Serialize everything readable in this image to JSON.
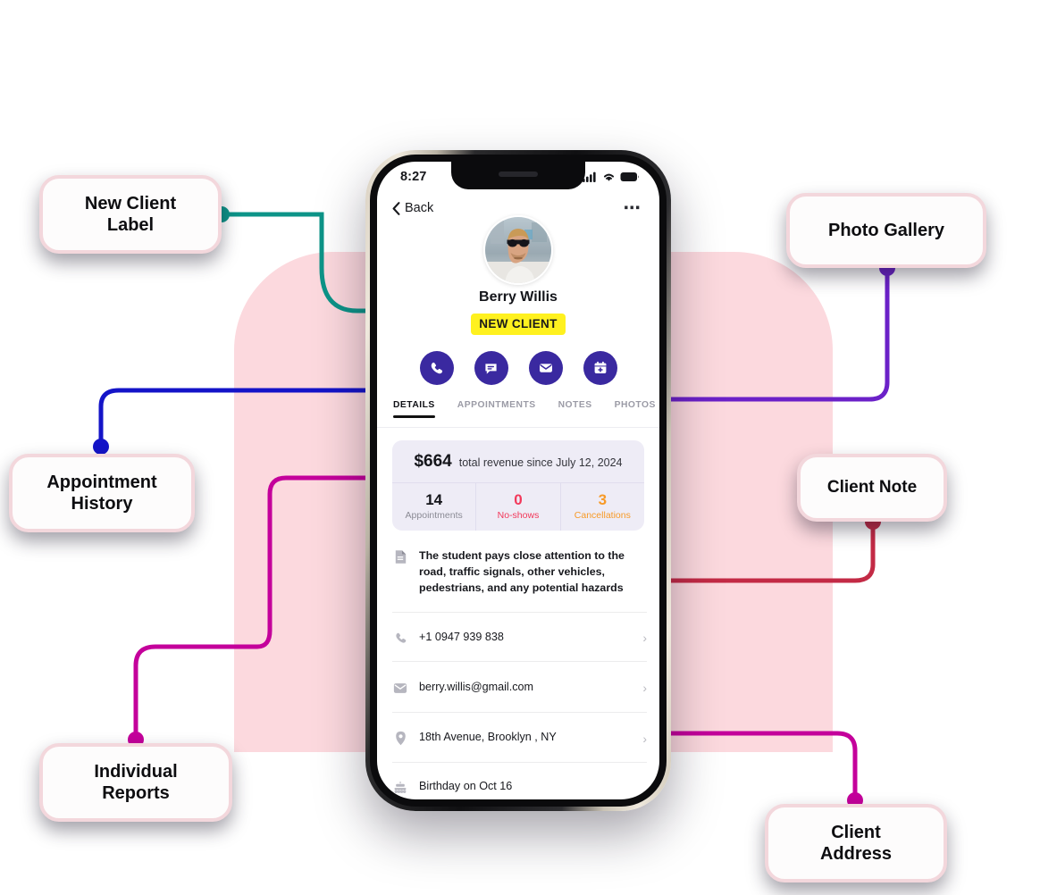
{
  "phone": {
    "status": {
      "time": "8:27",
      "signal_icon": "signal-bars-icon",
      "wifi_icon": "wifi-icon",
      "battery_icon": "battery-icon"
    },
    "nav": {
      "back_label": "Back",
      "back_icon": "chevron-left-icon",
      "more_icon": "more-options-icon"
    },
    "profile": {
      "avatar_icon": "client-avatar",
      "name": "Berry Willis",
      "badge": "NEW CLIENT"
    },
    "actions": [
      {
        "name": "call",
        "icon": "phone-icon"
      },
      {
        "name": "message",
        "icon": "chat-icon"
      },
      {
        "name": "email",
        "icon": "envelope-icon"
      },
      {
        "name": "book",
        "icon": "calendar-plus-icon"
      }
    ],
    "tabs": [
      {
        "label": "DETAILS",
        "active": true
      },
      {
        "label": "APPOINTMENTS",
        "active": false
      },
      {
        "label": "NOTES",
        "active": false
      },
      {
        "label": "PHOTOS",
        "active": false
      }
    ],
    "stats": {
      "revenue_amount": "$664",
      "revenue_text": "total revenue since July 12, 2024",
      "cells": [
        {
          "value": "14",
          "label": "Appointments",
          "color": "#14151a",
          "label_color": "#8b8b95"
        },
        {
          "value": "0",
          "label": "No-shows",
          "color": "#f2385a",
          "label_color": "#f2385a"
        },
        {
          "value": "3",
          "label": "Cancellations",
          "color": "#f79a28",
          "label_color": "#f79a28"
        }
      ]
    },
    "rows": [
      {
        "icon": "document-icon",
        "text": "The student pays close attention to the road, traffic signals, other vehicles, pedestrians, and any potential hazards",
        "chevron": false
      },
      {
        "icon": "phone-icon",
        "text": "+1 0947 939 838",
        "chevron": true
      },
      {
        "icon": "envelope-icon",
        "text": "berry.willis@gmail.com",
        "chevron": true
      },
      {
        "icon": "location-pin-icon",
        "text": "18th Avenue,  Brooklyn , NY",
        "chevron": true
      },
      {
        "icon": "birthday-cake-icon",
        "text": "Birthday on Oct 16",
        "chevron": false
      }
    ]
  },
  "callouts": [
    {
      "id": "new-client-label",
      "line1": "New Client",
      "line2": "Label",
      "color": "#0d9488"
    },
    {
      "id": "appointment-history",
      "line1": "Appointment",
      "line2": "History",
      "color": "#1414c8"
    },
    {
      "id": "individual-reports",
      "line1": "Individual",
      "line2": "Reports",
      "color": "#c4009b"
    },
    {
      "id": "photo-gallery",
      "line1": "Photo Gallery",
      "line2": "",
      "color": "#6b21c8"
    },
    {
      "id": "client-note",
      "line1": "Client Note",
      "line2": "",
      "color": "#c32a45"
    },
    {
      "id": "client-address",
      "line1": "Client",
      "line2": "Address",
      "color": "#c4009b"
    }
  ],
  "theme": {
    "blob": "#fcd9de",
    "badge_yellow": "#fff11f",
    "action_indigo": "#3a29a0",
    "callout_border": "#f3d7dc"
  }
}
